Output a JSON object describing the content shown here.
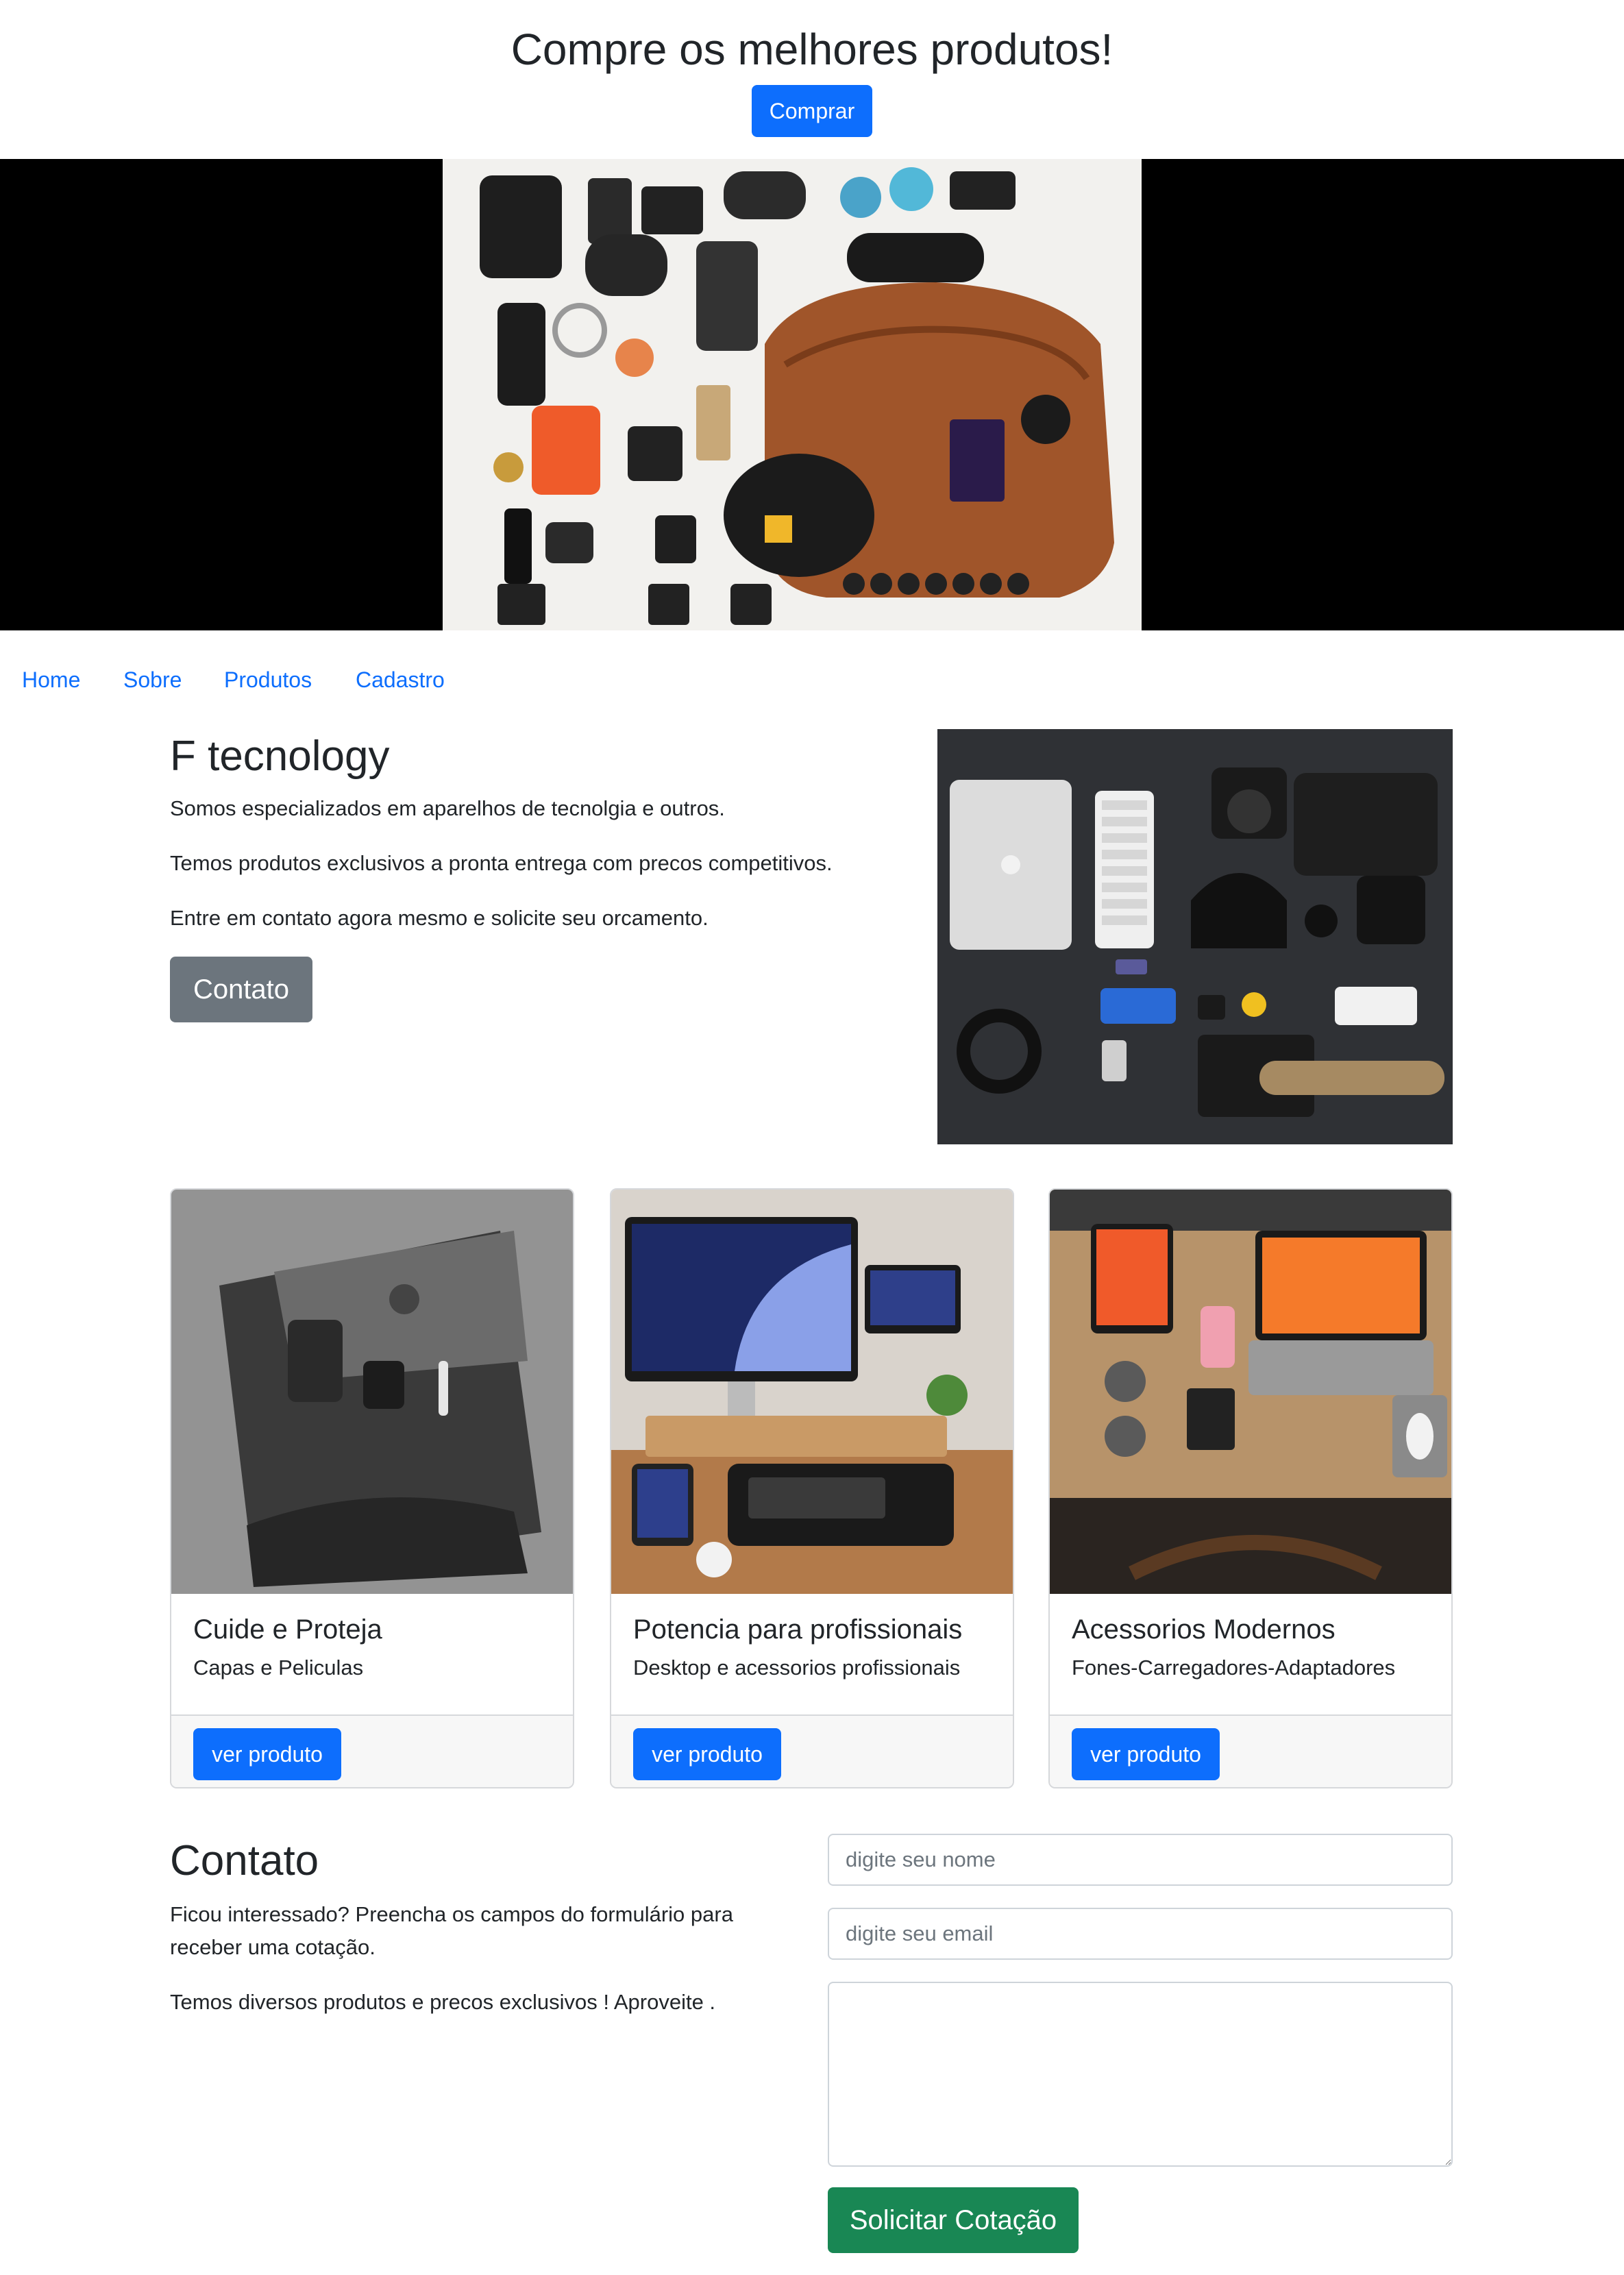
{
  "header": {
    "title": "Compre os melhores produtos!",
    "buy_button": "Comprar"
  },
  "nav": {
    "items": [
      {
        "label": "Home"
      },
      {
        "label": "Sobre"
      },
      {
        "label": "Produtos"
      },
      {
        "label": "Cadastro"
      }
    ]
  },
  "about": {
    "title": "F tecnology",
    "paragraphs": [
      "Somos especializados em aparelhos de tecnolgia e outros.",
      "Temos produtos exclusivos a pronta entrega com precos competitivos.",
      "Entre em contato agora mesmo e solicite seu orcamento."
    ],
    "contact_button": "Contato"
  },
  "cards": [
    {
      "title": "Cuide e Proteja",
      "text": "Capas e Peliculas",
      "button": "ver produto"
    },
    {
      "title": "Potencia para profissionais",
      "text": "Desktop e acessorios profissionais",
      "button": "ver produto"
    },
    {
      "title": "Acessorios Modernos",
      "text": "Fones-Carregadores-Adaptadores",
      "button": "ver produto"
    }
  ],
  "contact": {
    "title": "Contato",
    "paragraphs": [
      "Ficou interessado? Preencha os campos do formulário para receber uma cotação.",
      "Temos diversos produtos e precos exclusivos ! Aproveite ."
    ],
    "name_placeholder": "digite seu nome",
    "email_placeholder": "digite seu email",
    "submit_button": "Solicitar Cotação"
  },
  "colors": {
    "primary": "#0d6efd",
    "secondary": "#6c757d",
    "success": "#198754",
    "text": "#212529"
  }
}
